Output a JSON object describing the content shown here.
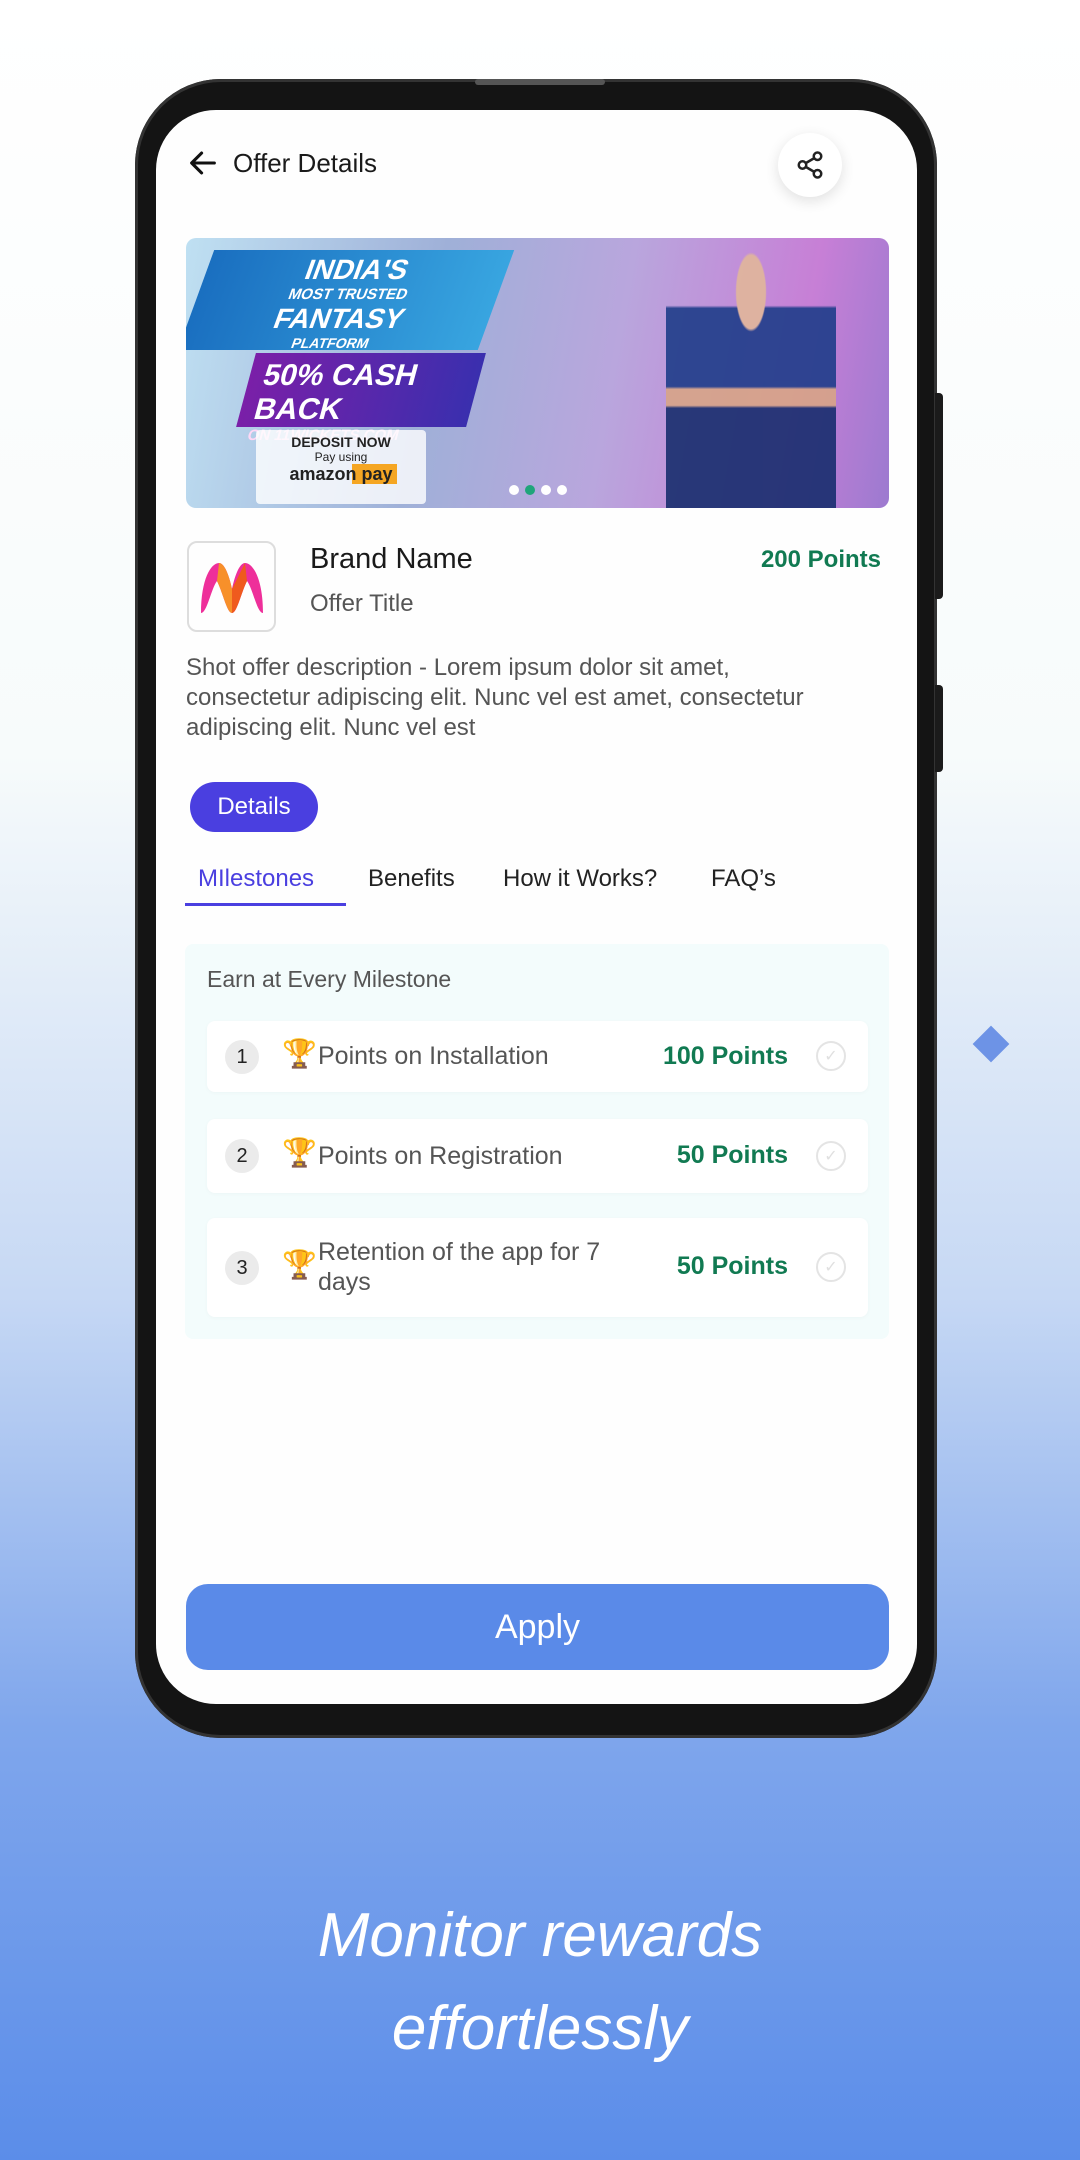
{
  "header": {
    "title": "Offer Details",
    "back_icon": "arrow-left-icon",
    "share_icon": "share-icon"
  },
  "banner": {
    "headline1": "INDIA'S",
    "headline2": "MOST TRUSTED",
    "headline3": "FANTASY",
    "headline4": "PLATFORM",
    "cashback": "50% CASH BACK",
    "site": "ON 11WICKETS.COM",
    "deposit": "DEPOSIT NOW",
    "pay_using": "Pay using",
    "pay_brand": "amazon pay",
    "slide_count": 4,
    "active_slide": 2
  },
  "offer": {
    "brand_name": "Brand Name",
    "offer_title": "Offer Title",
    "points": "200 Points",
    "description": "Shot offer description - Lorem ipsum dolor sit amet, consectetur adipiscing elit. Nunc vel est amet, consectetur adipiscing elit. Nunc vel est"
  },
  "details_label": "Details",
  "tabs": [
    {
      "label": "MIlestones",
      "active": true
    },
    {
      "label": "Benefits"
    },
    {
      "label": "How it Works?"
    },
    {
      "label": "FAQ’s"
    }
  ],
  "milestones": {
    "title": "Earn at Every Milestone",
    "items": [
      {
        "num": "1",
        "label": "Points on Installation",
        "points": "100 Points"
      },
      {
        "num": "2",
        "label": "Points on Registration",
        "points": "50 Points"
      },
      {
        "num": "3",
        "label": "Retention of the app for 7 days",
        "points": "50 Points"
      }
    ]
  },
  "apply_label": "Apply",
  "caption": {
    "line1": "Monitor rewards",
    "line2": "effortlessly"
  },
  "colors": {
    "accent": "#4a3fe0",
    "points": "#117a52",
    "apply": "#5a8ae8"
  }
}
